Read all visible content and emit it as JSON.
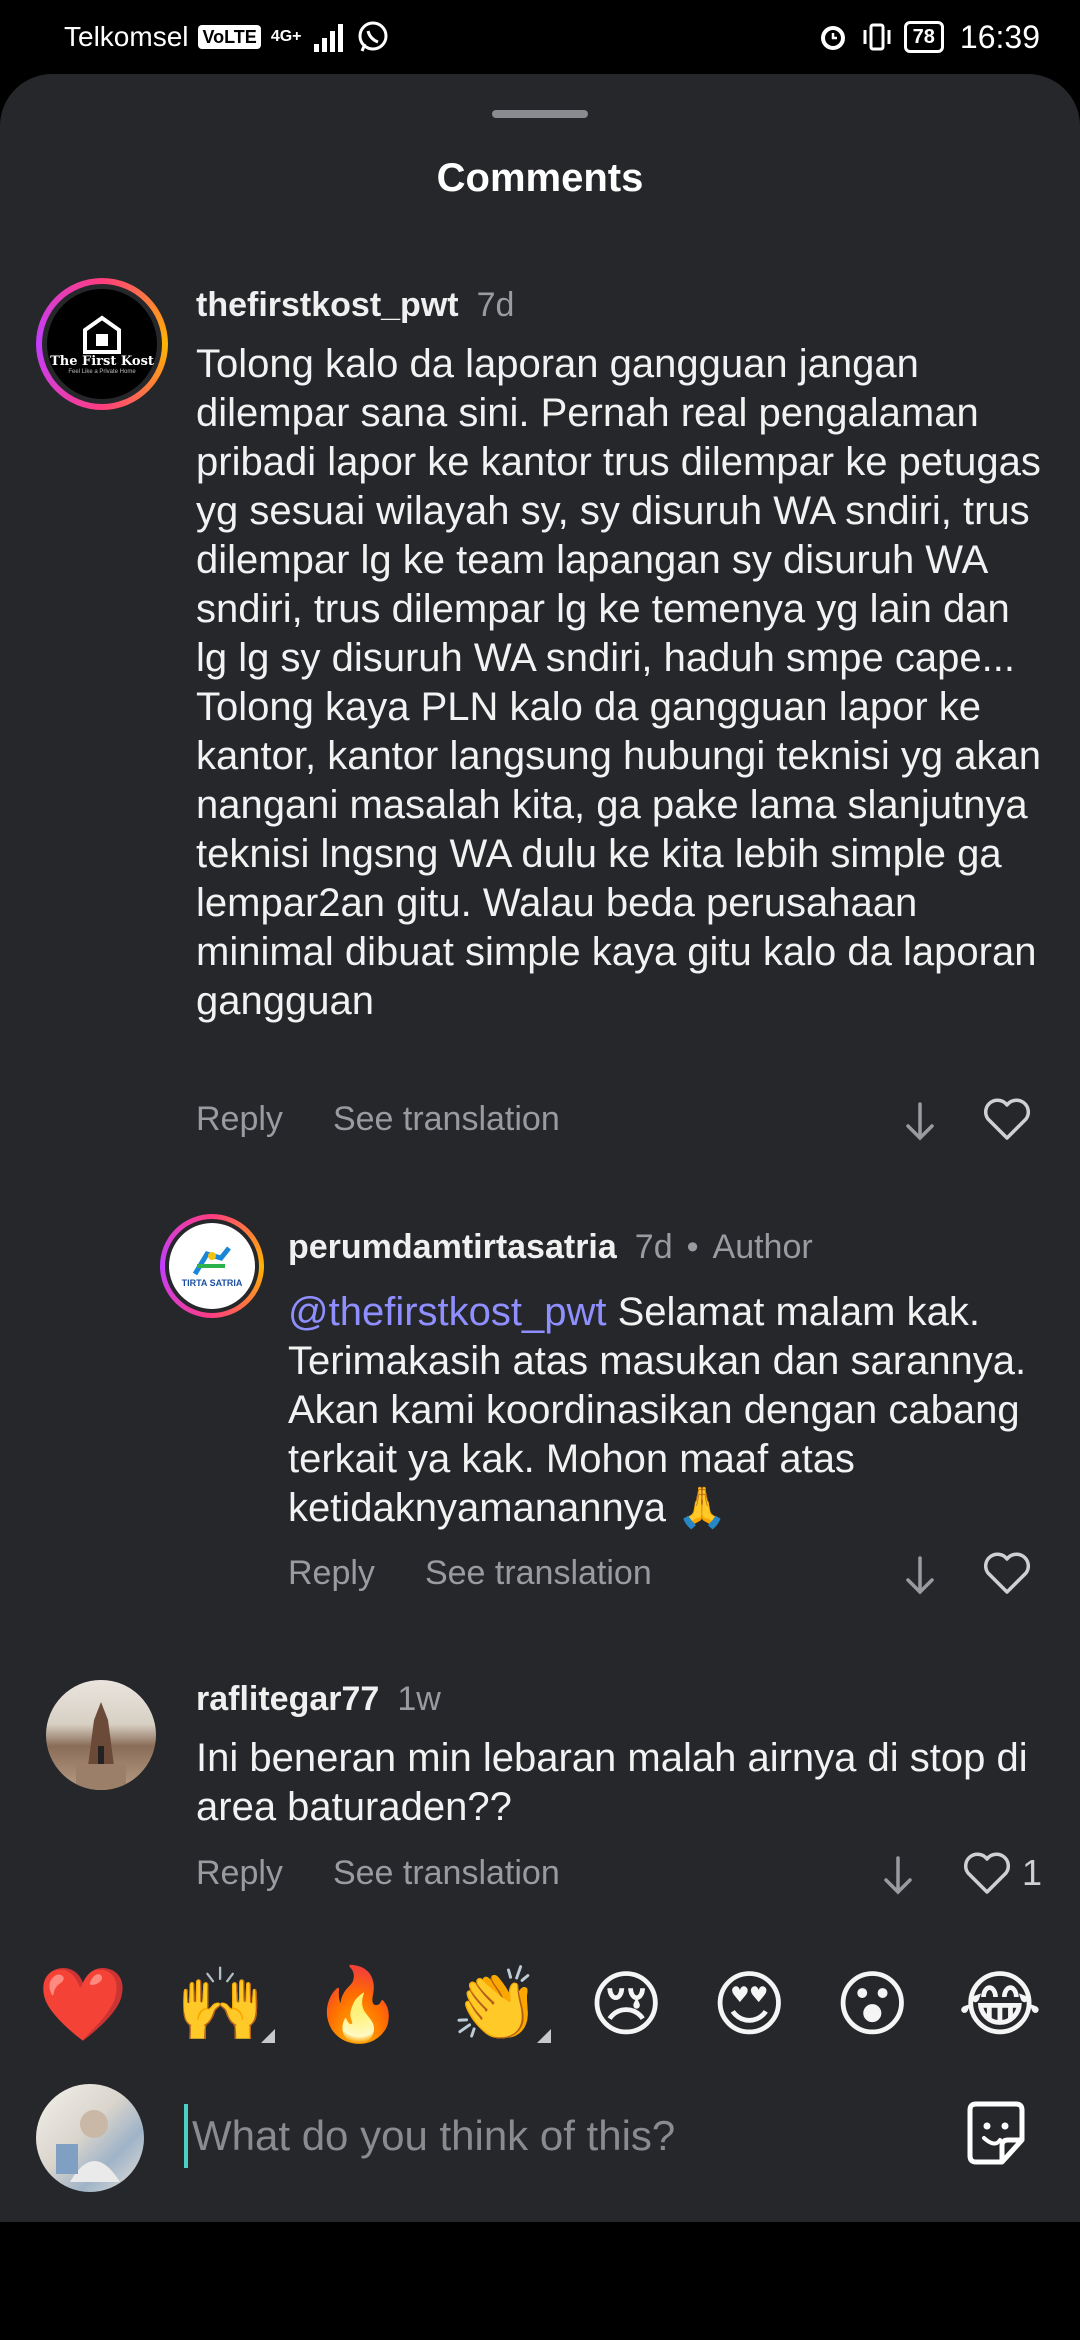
{
  "status_bar": {
    "carrier": "Telkomsel",
    "volte": "VoLTE",
    "network": "4G+",
    "battery": "78",
    "time": "16:39"
  },
  "sheet": {
    "title": "Comments"
  },
  "comments": [
    {
      "username": "thefirstkost_pwt",
      "time": "7d",
      "avatar_text": "The First Kost",
      "avatar_subtext": "Feel Like a Private Home",
      "text": "Tolong kalo da laporan gangguan jangan dilempar sana sini. Pernah real pengalaman pribadi lapor ke kantor trus dilempar ke petugas yg sesuai wilayah sy, sy disuruh WA sndiri, trus dilempar lg ke team lapangan sy disuruh WA sndiri, trus dilempar lg ke temenya yg lain dan lg lg sy disuruh WA sndiri, haduh smpe cape... Tolong kaya PLN kalo da gangguan lapor ke kantor, kantor langsung hubungi teknisi yg akan nangani masalah kita, ga pake lama slanjutnya teknisi lngsng WA dulu ke kita lebih simple ga lempar2an gitu. Walau beda perusahaan minimal dibuat simple kaya gitu kalo da laporan gangguan",
      "reply_label": "Reply",
      "translate_label": "See translation"
    },
    {
      "username": "perumdamtirtasatria",
      "time": "7d",
      "badge": "Author",
      "avatar_text": "TIRTA SATRIA",
      "mention": "@thefirstkost_pwt",
      "text": " Selamat malam kak. Terimakasih atas masukan dan sarannya. Akan kami koordinasikan dengan cabang terkait ya kak. Mohon maaf atas ketidaknyamanannya 🙏",
      "reply_label": "Reply",
      "translate_label": "See translation"
    },
    {
      "username": "raflitegar77",
      "time": "1w",
      "text": "Ini beneran min lebaran malah airnya di stop di area baturaden??",
      "reply_label": "Reply",
      "translate_label": "See translation",
      "like_count": "1"
    }
  ],
  "emoji_bar": [
    "❤️",
    "🙌",
    "🔥",
    "👏",
    "😢",
    "😍",
    "😮",
    "😂"
  ],
  "input": {
    "placeholder": "What do you think of this?"
  },
  "icons": {
    "dislike": "arrow-down-icon",
    "like": "heart-outline-icon",
    "sticker": "sticker-icon"
  }
}
